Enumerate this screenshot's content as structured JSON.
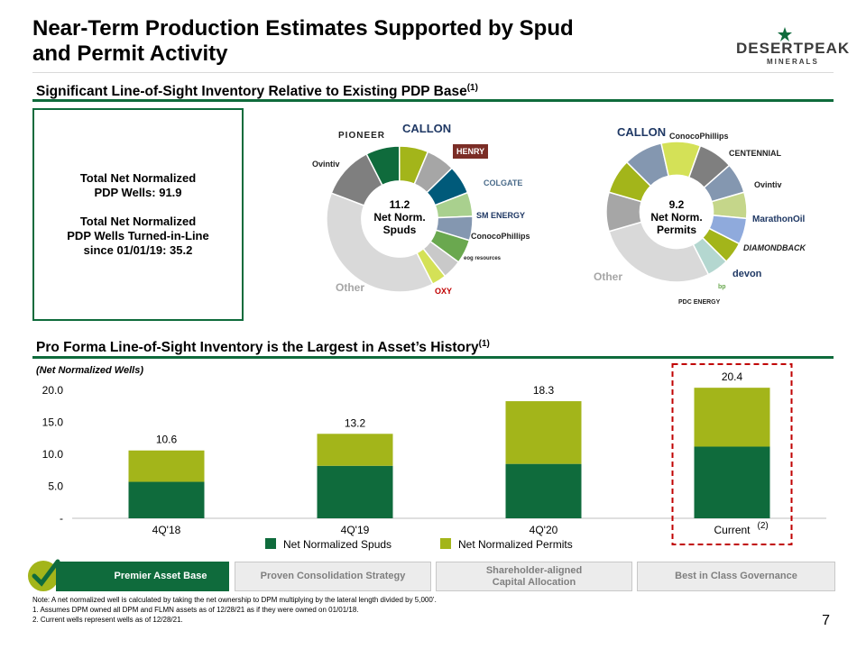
{
  "header": {
    "title_line1": "Near-Term Production Estimates Supported by Spud",
    "title_line2": "and Permit Activity",
    "logo_name": "DESERTPEAK",
    "logo_sub": "MINERALS"
  },
  "section1": {
    "title": "Significant Line-of-Sight Inventory Relative to Existing PDP Base",
    "sup": "(1)"
  },
  "pdp_box": {
    "line1": "Total Net Normalized",
    "line2": "PDP Wells: 91.9",
    "line3": "Total Net Normalized",
    "line4": "PDP Wells Turned-in-Line",
    "line5": "since 01/01/19: 35.2"
  },
  "donut_spuds": {
    "center_line1": "11.2",
    "center_line2": "Net Norm.",
    "center_line3": "Spuds",
    "other_label": "Other",
    "slice_colors": [
      "#d9d9d9",
      "#7f7f7f",
      "#0f6b3c",
      "#a3b51a",
      "#a6a6a6",
      "#005a7a",
      "#a9d08e",
      "#8497b0",
      "#6aa84f",
      "#c9c9c9",
      "#d4e157"
    ],
    "slice_fractions": [
      0.36,
      0.11,
      0.07,
      0.06,
      0.06,
      0.06,
      0.05,
      0.05,
      0.05,
      0.04,
      0.03
    ],
    "logos": [
      "PIONEER",
      "CALLON",
      "HENRY",
      "COLGATE",
      "SM ENERGY",
      "ConocoPhillips",
      "eog resources",
      "OXY",
      "Ovintiv"
    ]
  },
  "donut_permits": {
    "center_line1": "9.2",
    "center_line2": "Net Norm.",
    "center_line3": "Permits",
    "other_label": "Other",
    "slice_colors": [
      "#d9d9d9",
      "#a6a6a6",
      "#a3b51a",
      "#8497b0",
      "#d4e157",
      "#7f7f7f",
      "#8497b0",
      "#c5d68a",
      "#8faadc",
      "#a3b51a",
      "#b4d7d0"
    ],
    "slice_fractions": [
      0.28,
      0.09,
      0.08,
      0.09,
      0.09,
      0.08,
      0.07,
      0.06,
      0.06,
      0.05,
      0.05
    ],
    "logos": [
      "CALLON",
      "ConocoPhillips",
      "CENTENNIAL",
      "Ovintiv",
      "MarathonOil",
      "DIAMONDBACK",
      "devon",
      "bp",
      "PDC ENERGY"
    ]
  },
  "section2": {
    "title": "Pro Forma Line-of-Sight Inventory is the Largest in Asset’s History",
    "sup": "(1)"
  },
  "chart_data": {
    "type": "bar",
    "stacked": true,
    "unit_label": "(Net Normalized Wells)",
    "categories": [
      "4Q'18",
      "4Q'19",
      "4Q'20",
      "Current"
    ],
    "category_sup": [
      "",
      "",
      "",
      "(2)"
    ],
    "series": [
      {
        "name": "Net Normalized Spuds",
        "color": "#0f6b3c",
        "values": [
          5.7,
          8.2,
          8.5,
          11.2
        ]
      },
      {
        "name": "Net Normalized Permits",
        "color": "#a3b51a",
        "values": [
          4.9,
          5.0,
          9.8,
          9.2
        ]
      }
    ],
    "totals": [
      "10.6",
      "13.2",
      "18.3",
      "20.4"
    ],
    "yticks": [
      "-",
      "5.0",
      "10.0",
      "15.0",
      "20.0"
    ],
    "ylim": [
      0,
      20
    ],
    "highlight_category": "Current",
    "highlight_color": "#c00000"
  },
  "tabs": [
    {
      "label": "Premier Asset Base",
      "active": true
    },
    {
      "label": "Proven Consolidation Strategy",
      "active": false
    },
    {
      "label": "Shareholder-aligned",
      "label2": "Capital Allocation",
      "active": false
    },
    {
      "label": "Best in Class Governance",
      "active": false
    }
  ],
  "footnotes": {
    "note": "Note:  A net normalized well is calculated by taking the net ownership to DPM multiplying by the lateral length divided by 5,000’.",
    "n1": "1.      Assumes DPM owned all DPM and FLMN assets as of 12/28/21 as if they were owned on 01/01/18.",
    "n2": "2.      Current wells represent wells as of 12/28/21."
  },
  "page_number": "7"
}
